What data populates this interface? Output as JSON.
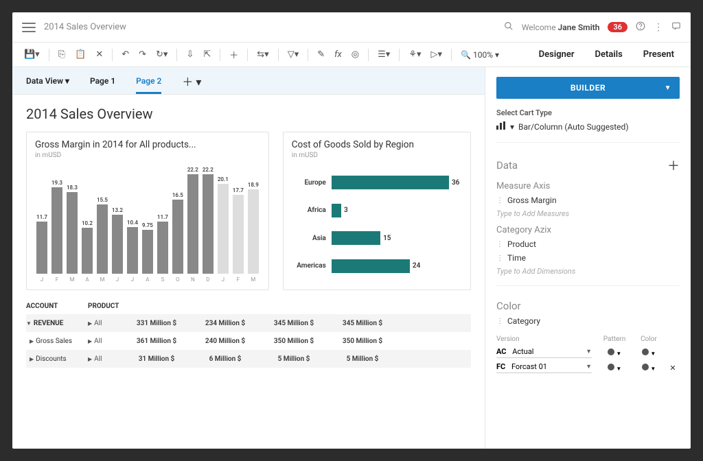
{
  "header": {
    "title": "2014 Sales Overview",
    "welcome_prefix": "Welcome ",
    "user_name": "Jane Smith",
    "notification_count": "36"
  },
  "toolbar": {
    "zoom_label": "100%"
  },
  "view_tabs": {
    "designer": "Designer",
    "details": "Details",
    "present": "Present"
  },
  "subtabs": {
    "data_view": "Data View",
    "page1": "Page 1",
    "page2": "Page 2"
  },
  "page": {
    "title": "2014 Sales Overview"
  },
  "chart1": {
    "title": "Gross Margin in 2014 for All products...",
    "subtitle": "in mUSD"
  },
  "chart2": {
    "title": "Cost of Goods Sold by Region",
    "subtitle": "in mUSD"
  },
  "chart_data": [
    {
      "type": "bar",
      "title": "Gross Margin in 2014 for All products...",
      "ylabel": "mUSD",
      "ylim": [
        0,
        23
      ],
      "categories": [
        "J",
        "F",
        "M",
        "A",
        "M",
        "J",
        "J",
        "A",
        "S",
        "O",
        "N",
        "D",
        "J",
        "F",
        "M"
      ],
      "series": [
        {
          "name": "Gross Margin",
          "values": [
            11.7,
            19.3,
            18.3,
            10.2,
            15.5,
            13.2,
            10.4,
            9.75,
            11.7,
            16.5,
            22.2,
            22.2,
            20.1,
            17.7,
            18.9
          ]
        },
        {
          "name": "Faded",
          "values": [
            false,
            false,
            false,
            false,
            false,
            false,
            false,
            false,
            false,
            false,
            false,
            false,
            true,
            true,
            true
          ]
        }
      ]
    },
    {
      "type": "bar",
      "orientation": "horizontal",
      "title": "Cost of Goods Sold by Region",
      "xlabel": "mUSD",
      "xlim": [
        0,
        40
      ],
      "categories": [
        "Europe",
        "Africa",
        "Asia",
        "Americas"
      ],
      "values": [
        36,
        3,
        15,
        24
      ]
    }
  ],
  "table": {
    "headers": {
      "account": "ACCOUNT",
      "product": "PRODUCT"
    },
    "rows": [
      {
        "account": "REVENUE",
        "product": "All",
        "values": [
          "331 Million $",
          "234 Million $",
          "345 Million $",
          "345 Million $"
        ],
        "shade": true,
        "expandable": true
      },
      {
        "account": "Gross Sales",
        "product": "All",
        "values": [
          "361 Million $",
          "240 Million $",
          "350 Million $",
          "350 Million $"
        ],
        "shade": false,
        "indent": true
      },
      {
        "account": "Discounts",
        "product": "All",
        "values": [
          "31 Million $",
          "6 Million $",
          "5 Million $",
          "5 Million $"
        ],
        "shade": true,
        "indent": true
      }
    ]
  },
  "sidebar": {
    "builder": "BUILDER",
    "select_chart_type_label": "Select Cart Type",
    "chart_type_value": "Bar/Column (Auto Suggested)",
    "data_section": "Data",
    "measure_axis_label": "Measure Axis",
    "measure_item": "Gross Margin",
    "measure_placeholder": "Type to Add Measures",
    "category_axis_label": "Category Azix",
    "category_item1": "Product",
    "category_item2": "Time",
    "category_placeholder": "Type to Add Dimensions",
    "color_section": "Color",
    "color_item": "Category",
    "version_header": {
      "version": "Version",
      "pattern": "Pattern",
      "color": "Color"
    },
    "version_rows": [
      {
        "name": "AC Actual",
        "closable": false
      },
      {
        "name": "FC Forcast 01",
        "closable": true
      }
    ]
  }
}
